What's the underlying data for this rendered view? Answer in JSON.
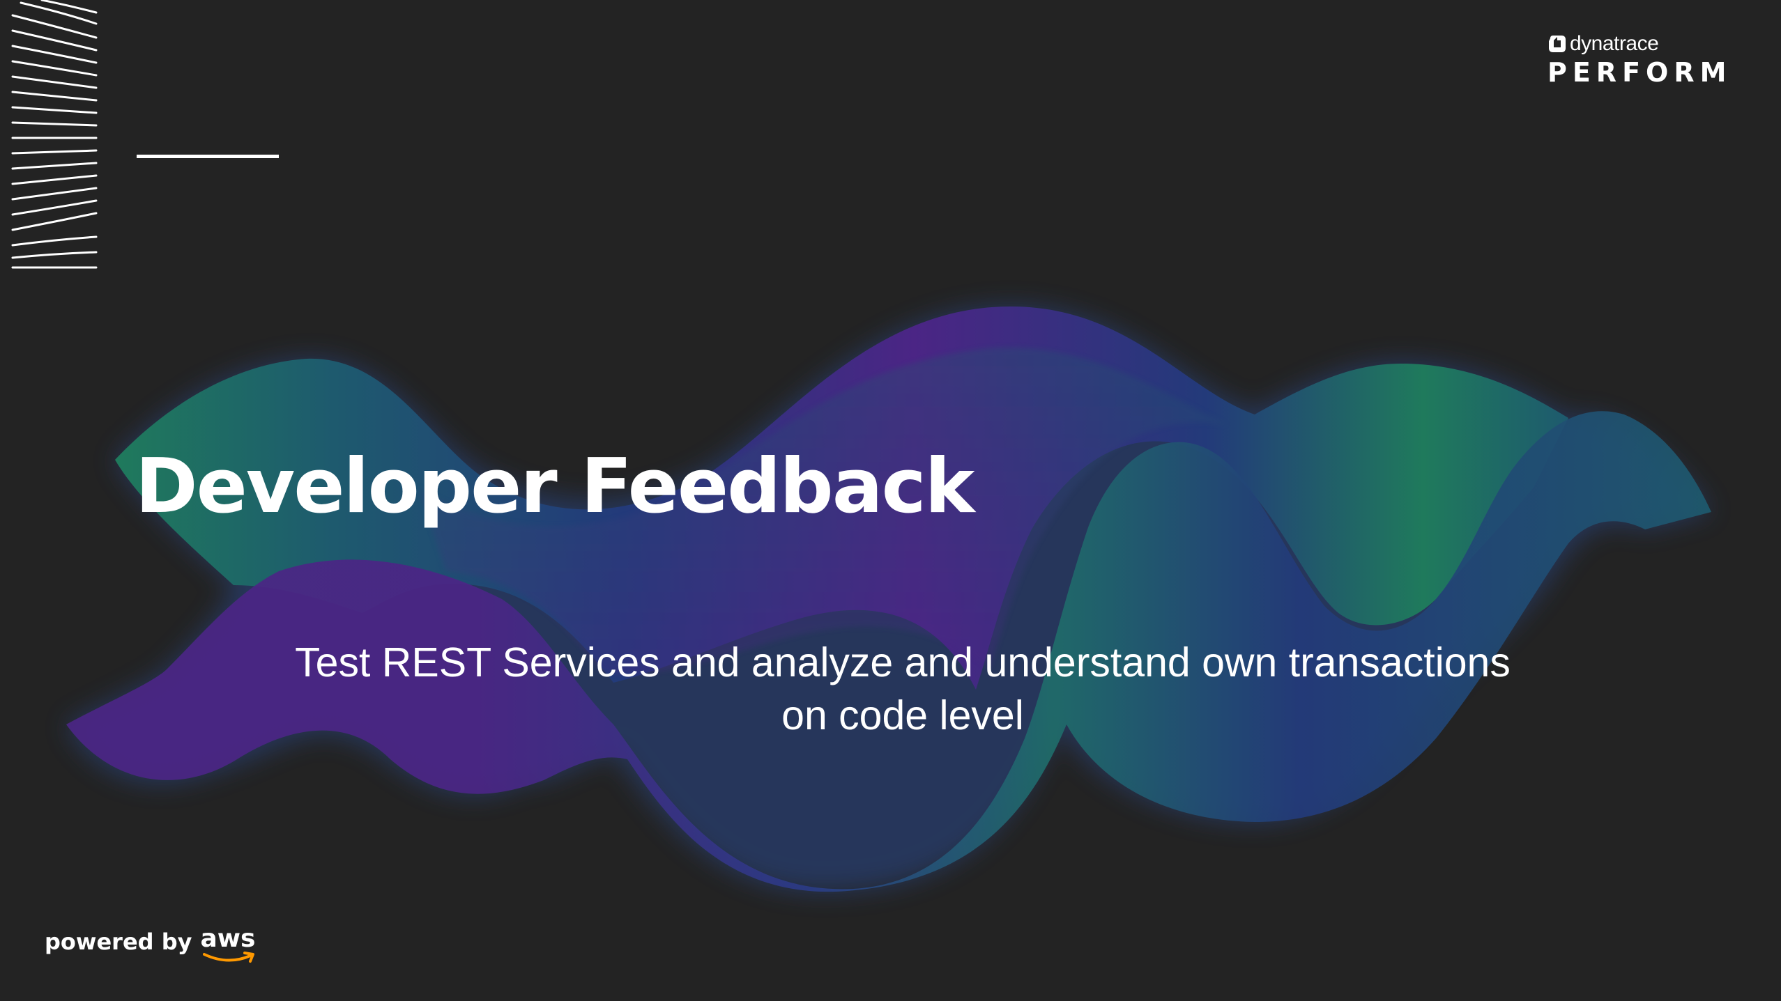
{
  "slide": {
    "title": "Developer Feedback",
    "subtitle_line1": "Test REST Services and analyze and understand own transactions",
    "subtitle_line2": "on code level"
  },
  "branding": {
    "company": "dynatrace",
    "event": "PERFORM",
    "powered_by": "powered by",
    "partner": "aws"
  },
  "icons": {
    "dynatrace_logo": "dynatrace-logo-icon",
    "aws_smile": "aws-smile-icon",
    "corner_pattern": "diagonal-lines-pattern"
  },
  "colors": {
    "background": "#232323",
    "wave_green": "#1f7a5c",
    "wave_teal": "#1e5a6e",
    "wave_blue": "#233a7a",
    "wave_purple": "#4b2585",
    "aws_orange": "#ff9900",
    "text": "#ffffff"
  }
}
